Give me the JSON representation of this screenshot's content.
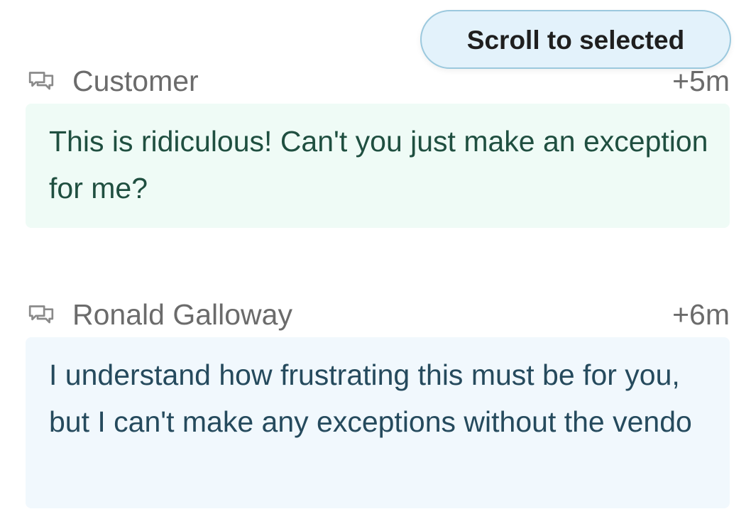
{
  "scroll_button": {
    "label": "Scroll to selected"
  },
  "messages": [
    {
      "speaker": "Customer",
      "time": "+5m",
      "text": "This is ridiculous! Can't you just make an exception for me?",
      "icon": "chat-bubbles-icon",
      "bubble_color": "#effbf6"
    },
    {
      "speaker": "Ronald Galloway",
      "time": "+6m",
      "text": "I understand how frustrating this must be for you, but I can't make any exceptions without the vendo",
      "icon": "chat-bubbles-icon",
      "bubble_color": "#f1f8fd"
    }
  ]
}
